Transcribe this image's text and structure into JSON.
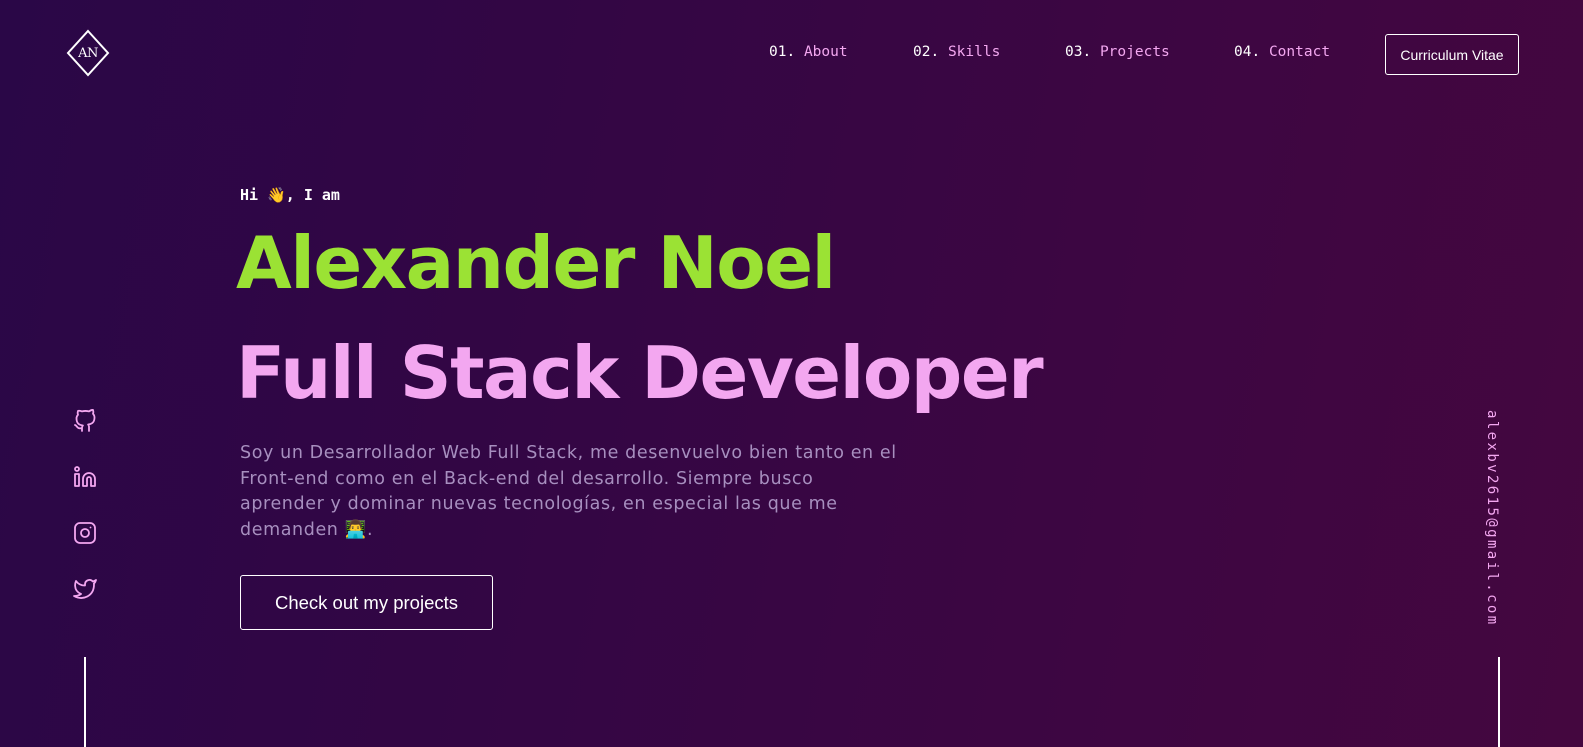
{
  "header": {
    "logo_text": "AN",
    "nav": [
      {
        "num": "01.",
        "label": "About"
      },
      {
        "num": "02.",
        "label": "Skills"
      },
      {
        "num": "03.",
        "label": "Projects"
      },
      {
        "num": "04.",
        "label": "Contact"
      }
    ],
    "cv_label": "Curriculum Vitae"
  },
  "hero": {
    "greeting": "Hi 👋, I am",
    "name": "Alexander Noel",
    "role": "Full Stack Developer",
    "bio": "Soy un Desarrollador Web Full Stack, me desenvuelvo bien tanto en el Front-end como en el Back-end del desarrollo. Siempre busco aprender y dominar nuevas tecnologías, en especial las que me demanden 👨‍💻.",
    "cta_label": "Check out my projects"
  },
  "social": [
    {
      "icon": "github-icon"
    },
    {
      "icon": "linkedin-icon"
    },
    {
      "icon": "instagram-icon"
    },
    {
      "icon": "twitter-icon"
    }
  ],
  "email": "alexbv2615@gmail.com",
  "colors": {
    "accent_green": "#9be234",
    "accent_pink": "#f3a7f0",
    "muted_text": "#a78fbf",
    "background_start": "#2a0747",
    "background_end": "#44073f"
  }
}
